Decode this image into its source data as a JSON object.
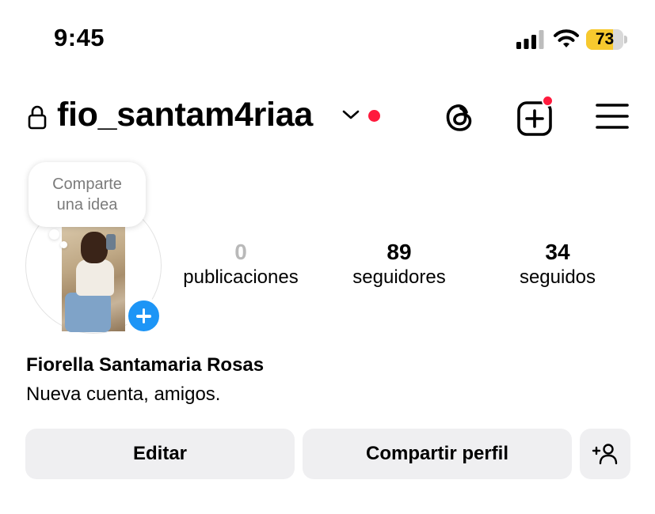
{
  "status_bar": {
    "time": "9:45",
    "battery_level": "73",
    "battery_color": "#f7c92e"
  },
  "header": {
    "lock_icon": "lock-icon",
    "username": "fio_santam4riaa",
    "notification_dot_color": "#ff1a3d",
    "icons": [
      "threads-icon",
      "new-post-icon",
      "menu-icon"
    ]
  },
  "profile": {
    "note_bubble": {
      "line1": "Comparte",
      "line2": "una idea"
    },
    "stats": {
      "posts": {
        "value": "0",
        "label": "publicaciones"
      },
      "followers": {
        "value": "89",
        "label": "seguidores"
      },
      "following": {
        "value": "34",
        "label": "seguidos"
      }
    },
    "full_name": "Fiorella Santamaria Rosas",
    "bio": "Nueva cuenta, amigos.",
    "accent_color": "#1d95f6"
  },
  "actions": {
    "edit_label": "Editar",
    "share_label": "Compartir perfil",
    "discover_icon": "add-person-icon"
  }
}
